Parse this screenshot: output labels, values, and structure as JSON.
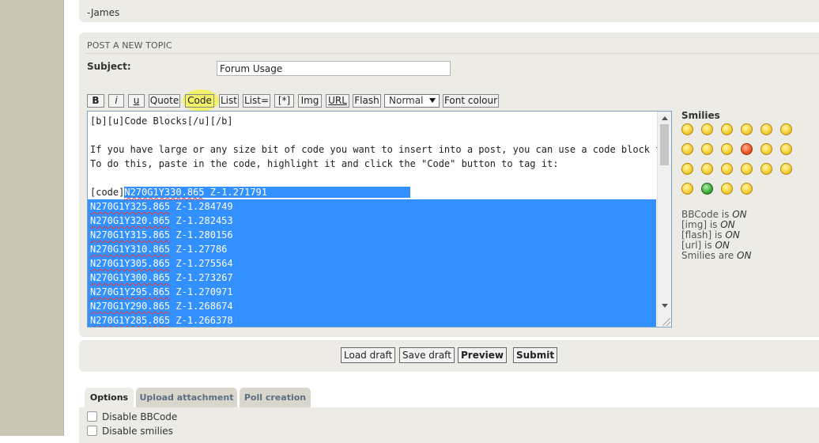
{
  "signature": "-James",
  "post": {
    "heading": "POST A NEW TOPIC",
    "subject_label": "Subject:",
    "subject_value": "Forum Usage"
  },
  "toolbar": {
    "bold": "B",
    "italic": "i",
    "underline": "u",
    "quote": "Quote",
    "code": "Code",
    "list": "List",
    "list_eq": "List=",
    "list_item": "[*]",
    "img": "Img",
    "url": "URL",
    "flash": "Flash",
    "size": "Normal",
    "font_colour": "Font colour"
  },
  "editor": {
    "line1": "[b][u]Code Blocks[/u][/b]",
    "line2": "",
    "line3": "If you have large or any size bit of code you want to insert into a post, you can use a code block to encapsulate the code.",
    "line4": "To do this, paste in the code, highlight it and click the \"Code\" button to tag it:",
    "line5": "",
    "code_tag": "[code]",
    "first_code_part1": "N270G1Y330.865",
    "first_code_part2": " Z-1.271791",
    "code_lines": [
      [
        "N270G1Y325.865",
        " Z-1.284749"
      ],
      [
        "N270G1Y320.865",
        " Z-1.282453"
      ],
      [
        "N270G1Y315.865",
        " Z-1.280156"
      ],
      [
        "N270G1Y310.865",
        " Z-1.27786"
      ],
      [
        "N270G1Y305.865",
        " Z-1.275564"
      ],
      [
        "N270G1Y300.865",
        " Z-1.273267"
      ],
      [
        "N270G1Y295.865",
        " Z-1.270971"
      ],
      [
        "N270G1Y290.865",
        " Z-1.268674"
      ],
      [
        "N270G1Y285.865",
        " Z-1.266378"
      ]
    ]
  },
  "smilies": {
    "title": "Smilies",
    "icons": [
      "grin-smiley-icon",
      "smile-smiley-icon",
      "wink-smiley-icon",
      "surprised-smiley-icon",
      "shocked-smiley-icon",
      "confused-smiley-icon",
      "cool-smiley-icon",
      "laugh-smiley-icon",
      "tongue-smiley-icon",
      "angry-smiley-icon",
      "neutral-smiley-icon",
      "evil-smiley-icon",
      "twisted-smiley-icon",
      "rolleyes-smiley-icon",
      "exclaim-smiley-icon",
      "question-smiley-icon",
      "idea-smiley-icon",
      "arrow-smiley-icon",
      "sad-smiley-icon",
      "mrgreen-smiley-icon",
      "geek-smiley-icon",
      "uber-geek-smiley-icon"
    ]
  },
  "bbcode_status": {
    "bbcode": "BBCode is",
    "img": "[img] is",
    "flash": "[flash] is",
    "url": "[url] is",
    "smilies": "Smilies are",
    "on": "ON"
  },
  "actions": {
    "load_draft": "Load draft",
    "save_draft": "Save draft",
    "preview": "Preview",
    "submit": "Submit"
  },
  "tabs": {
    "options": "Options",
    "upload": "Upload attachment",
    "poll": "Poll creation"
  },
  "options": {
    "disable_bbcode": "Disable BBCode",
    "disable_smilies": "Disable smilies"
  }
}
